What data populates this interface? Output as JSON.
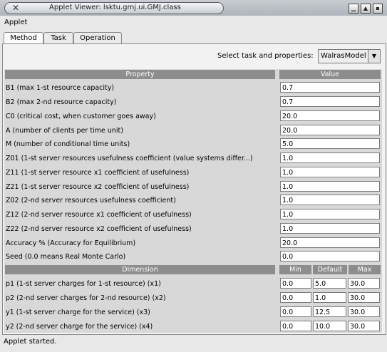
{
  "window": {
    "title": "Applet Viewer: lsktu.gmj.ui.GMJ.class",
    "close_glyph": "✕",
    "btn_min": "▁",
    "btn_max": "▲",
    "btn_close": "▪"
  },
  "menu": {
    "items": [
      "Applet"
    ]
  },
  "tabs": [
    "Method",
    "Task",
    "Operation"
  ],
  "selector": {
    "label": "Select task and properties:",
    "value": "WalrasModel"
  },
  "properties": {
    "header_property": "Property",
    "header_value": "Value",
    "rows": [
      {
        "label": "B1 (max 1-st resource capacity)",
        "value": "0.7"
      },
      {
        "label": "B2 (max 2-nd resource capacity)",
        "value": "0.7"
      },
      {
        "label": "C0 (critical cost, when customer goes away)",
        "value": "20.0"
      },
      {
        "label": "A (number of clients per time unit)",
        "value": "20.0"
      },
      {
        "label": "M (number of conditional time units)",
        "value": "5.0"
      },
      {
        "label": "Z01 (1-st server resources usefulness coefficient (value systems differ...)",
        "value": "1.0"
      },
      {
        "label": "Z11 (1-st server resource x1 coefficient of usefulness)",
        "value": "1.0"
      },
      {
        "label": "Z21 (1-st server resource x2 coefficient of usefulness)",
        "value": "1.0"
      },
      {
        "label": "Z02 (2-nd server resources usefulness coefficient)",
        "value": "1.0"
      },
      {
        "label": "Z12 (2-nd server resource x1 coefficient of usefulness)",
        "value": "1.0"
      },
      {
        "label": "Z22 (2-nd server resource x2 coefficient of usefulness)",
        "value": "1.0"
      },
      {
        "label": "Accuracy % (Accuracy for Equilibrium)",
        "value": "20.0"
      },
      {
        "label": "Seed (0.0 means Real Monte Carlo)",
        "value": "0.0"
      }
    ]
  },
  "dimensions": {
    "header_dimension": "Dimension",
    "header_min": "Min",
    "header_default": "Default",
    "header_max": "Max",
    "rows": [
      {
        "label": "p1 (1-st server charges for 1-st resource) (x1)",
        "min": "0.0",
        "default": "5.0",
        "max": "30.0"
      },
      {
        "label": "p2 (2-nd server charges for 2-nd resource) (x2)",
        "min": "0.0",
        "default": "1.0",
        "max": "30.0"
      },
      {
        "label": "y1 (1-st server charge for the service) (x3)",
        "min": "0.0",
        "default": "12.5",
        "max": "30.0"
      },
      {
        "label": "y2 (2-nd server charge for the service) (x4)",
        "min": "0.0",
        "default": "10.0",
        "max": "30.0"
      }
    ]
  },
  "status": {
    "text": "Applet started."
  }
}
